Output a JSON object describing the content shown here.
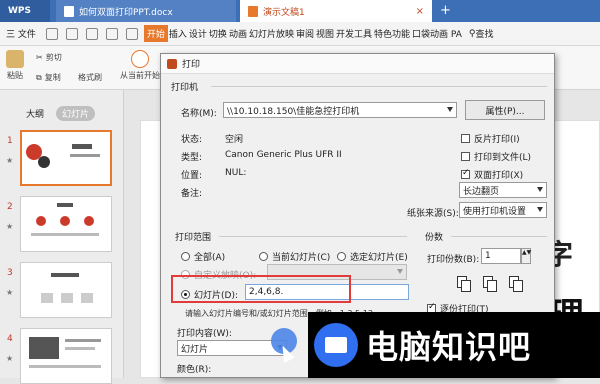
{
  "titlebar": {
    "app": "WPS",
    "tabs": [
      {
        "label": "如何双面打印PPT.docx"
      },
      {
        "label": "演示文稿1"
      }
    ]
  },
  "menubar": {
    "file": "三 文件",
    "items": [
      "开始",
      "插入",
      "设计",
      "切换",
      "动画",
      "幻灯片放映",
      "审阅",
      "视图",
      "开发工具",
      "特色功能",
      "口袋动画 PA"
    ],
    "search": "查找"
  },
  "ribbon": {
    "paste": "粘贴",
    "cut": "剪切",
    "copy": "复制",
    "format_painter": "格式刷",
    "from_current": "从当前开始"
  },
  "left_panel": {
    "tabs": [
      "大纲",
      "幻灯片"
    ],
    "slide_numbers": [
      "1",
      "2",
      "3",
      "4"
    ]
  },
  "dialog": {
    "title": "打印",
    "printer_section": "打印机",
    "name_label": "名称(M):",
    "printer_name": "\\\\10.10.18.150\\佳能急控打印机",
    "properties_button": "属性(P)...",
    "status_label": "状态:",
    "status_value": "空闲",
    "type_label": "类型:",
    "type_value": "Canon Generic Plus UFR II",
    "location_label": "位置:",
    "location_value": "NUL:",
    "comment_label": "备注:",
    "reverse_print": "反片打印(I)",
    "print_to_file": "打印到文件(L)",
    "duplex_print": "双面打印(X)",
    "duplex_mode": "长边翻页",
    "paper_source_label": "纸张来源(S):",
    "paper_source_value": "使用打印机设置",
    "range_section": "打印范围",
    "all": "全部(A)",
    "current_slide": "当前幻灯片(C)",
    "selected_slide": "选定幻灯片(E)",
    "custom_show": "自定义放映(O):",
    "slides_label": "幻灯片(D):",
    "slides_value": "2,4,6,8.",
    "hint": "请输入幻灯片编号和/或幻灯片范围。例如，1,3,5-12",
    "copies_section": "份数",
    "copies_label": "打印份数(B):",
    "copies_value": "1",
    "collate": "逐份打印(T)",
    "content_label": "打印内容(W):",
    "content_value": "幻灯片",
    "color_label": "颜色(R):"
  },
  "banner": {
    "text": "电脑知识吧"
  },
  "slide_canvas": {
    "char1": "理",
    "char2": "字"
  },
  "colors": {
    "titlebar": "#3c6fb6",
    "accent": "#e7792d",
    "highlight_frame": "#e23b3b"
  }
}
